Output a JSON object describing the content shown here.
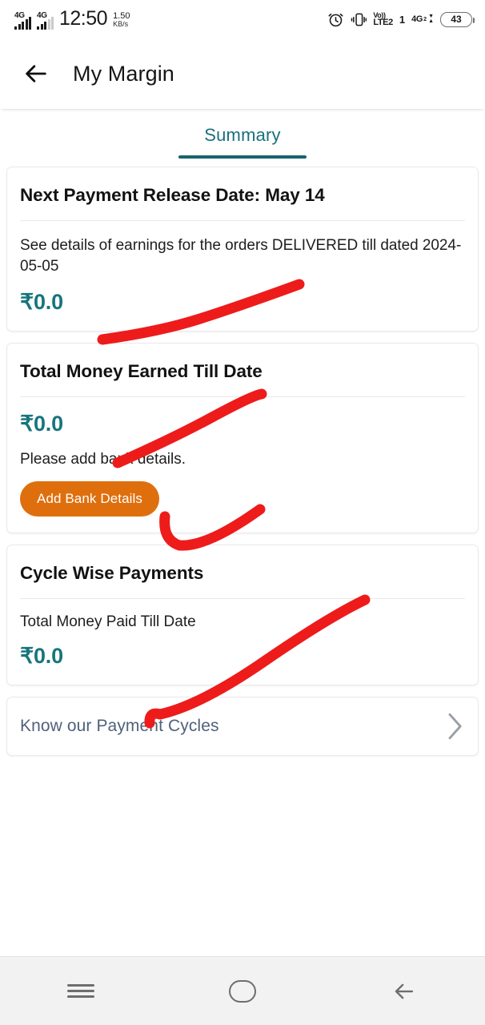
{
  "status_bar": {
    "network_label_1": "4G",
    "network_label_2": "4G",
    "time": "12:50",
    "data_speed_value": "1.50",
    "data_speed_unit": "KB/s",
    "alarm_icon": "alarm-clock-icon",
    "vibrate_icon": "vibrate-icon",
    "volte_top": "Vo))",
    "volte_bottom": "LTE2",
    "sim_index": "1",
    "network_right_label": "4G",
    "network_right_sub": "2",
    "battery_percent": "43"
  },
  "app_bar": {
    "back_icon": "back-arrow-icon",
    "title": "My Margin"
  },
  "tabs": [
    {
      "label": "Summary",
      "active": true
    }
  ],
  "cards": [
    {
      "id": "next-payment-release",
      "title": "Next Payment Release Date: May 14",
      "description": "See details of earnings for the orders DELIVERED till dated 2024-05-05",
      "amount": "₹0.0"
    },
    {
      "id": "total-money-earned",
      "title": "Total Money Earned Till Date",
      "amount": "₹0.0",
      "note": "Please add bank details.",
      "button_label": "Add Bank Details"
    },
    {
      "id": "cycle-wise-payments",
      "title": "Cycle Wise Payments",
      "paid_label": "Total Money Paid Till Date",
      "amount": "₹0.0"
    }
  ],
  "link_row": {
    "label": "Know our Payment Cycles",
    "chevron_icon": "chevron-right-icon"
  },
  "annotations": {
    "color": "#ee1b1b",
    "strokes": [
      "underline-next-payment-amount",
      "underline-total-money-earned-title",
      "checkmark-add-bank-details",
      "hook-cycle-wise-payments"
    ]
  },
  "nav_bar": {
    "recents_icon": "recents-icon",
    "home_icon": "home-icon",
    "back_icon": "back-arrow-icon"
  },
  "colors": {
    "accent_teal": "#17757c",
    "tab_active": "#19707c",
    "button_orange": "#df6f0d",
    "link_slate": "#50617a",
    "annotation_red": "#ee1b1b"
  }
}
